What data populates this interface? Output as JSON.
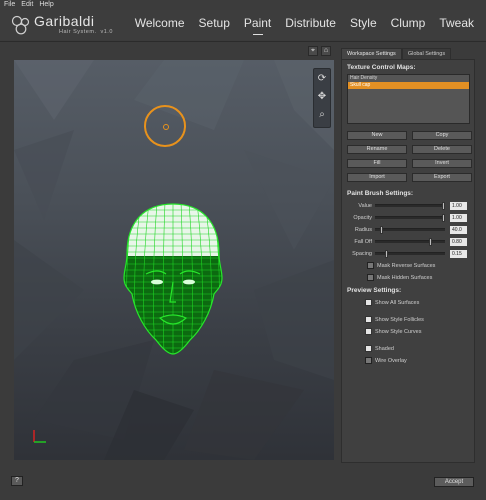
{
  "menu": [
    "File",
    "Edit",
    "Help"
  ],
  "app": {
    "title": "Garibaldi",
    "subtitle": "Hair System.",
    "version": "v1.0"
  },
  "nav": [
    "Welcome",
    "Setup",
    "Paint",
    "Distribute",
    "Style",
    "Clump",
    "Tweak"
  ],
  "nav_active": "Paint",
  "viewport_tools": {
    "frame_icon": "target-icon",
    "home_icon": "home-icon"
  },
  "tabs": [
    "Workspace Settings",
    "Global Settings"
  ],
  "texture": {
    "title": "Texture Control Maps:",
    "items": [
      "Hair Density",
      "Skull cap"
    ],
    "selected_index": 1,
    "buttons": [
      "New",
      "Copy",
      "Rename",
      "Delete",
      "Fill",
      "Invert",
      "Import",
      "Export"
    ]
  },
  "brush": {
    "title": "Paint Brush Settings:",
    "sliders": [
      {
        "label": "Value",
        "value": "1.00",
        "fraction": 1.0
      },
      {
        "label": "Opacity",
        "value": "1.00",
        "fraction": 1.0
      },
      {
        "label": "Radius",
        "value": "40.0",
        "fraction": 0.08
      },
      {
        "label": "Fall Off",
        "value": "0.80",
        "fraction": 0.8
      },
      {
        "label": "Spacing",
        "value": "0.15",
        "fraction": 0.15
      }
    ],
    "checks": [
      {
        "label": "Mask Reverse Surfaces",
        "checked": false
      },
      {
        "label": "Mask Hidden Surfaces",
        "checked": false
      }
    ]
  },
  "preview": {
    "title": "Preview Settings:",
    "checks": [
      {
        "label": "Show All Surfaces",
        "checked": false
      },
      {
        "label": "Show Style Follicles",
        "checked": false
      },
      {
        "label": "Show Style Curves",
        "checked": false
      },
      {
        "label": "Shaded",
        "checked": false
      },
      {
        "label": "Wire Overlay",
        "checked": false
      }
    ]
  },
  "footer": {
    "help_label": "?",
    "accept_label": "Accept"
  },
  "colors": {
    "accent": "#e39024",
    "wire": "#27e62b",
    "axis_x": "#e02020",
    "axis_y": "#20d020"
  }
}
